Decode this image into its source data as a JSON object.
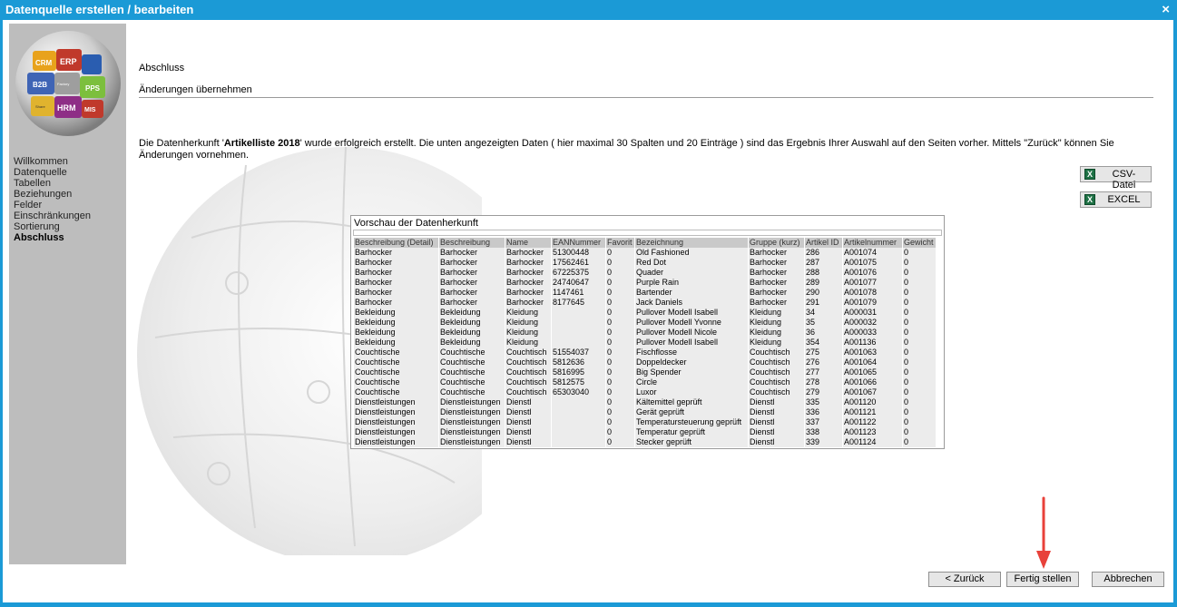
{
  "window": {
    "title": "Datenquelle erstellen / bearbeiten",
    "close_glyph": "×"
  },
  "logo": {
    "labels": [
      "CRM",
      "ERP",
      "B2B",
      "PPS",
      "HRM",
      "MIS"
    ],
    "small_labels": [
      "Factory",
      "Share"
    ]
  },
  "sidebar": {
    "items": [
      {
        "label": "Willkommen",
        "active": false
      },
      {
        "label": "Datenquelle",
        "active": false
      },
      {
        "label": "Tabellen",
        "active": false
      },
      {
        "label": "Beziehungen",
        "active": false
      },
      {
        "label": "Felder",
        "active": false
      },
      {
        "label": "Einschränkungen",
        "active": false
      },
      {
        "label": "Sortierung",
        "active": false
      },
      {
        "label": "Abschluss",
        "active": true
      }
    ]
  },
  "main": {
    "title": "Abschluss",
    "subtitle": "Änderungen übernehmen",
    "message_before": "Die Datenherkunft '",
    "message_name": "Artikelliste 2018",
    "message_after": "' wurde erfolgreich erstellt. Die unten angezeigten Daten ( hier maximal 30 Spalten und 20 Einträge ) sind das Ergebnis Ihrer Auswahl auf den Seiten vorher. Mittels \"Zurück\" können Sie Änderungen vornehmen."
  },
  "export": {
    "csv_label": "CSV-Datei",
    "excel_label": "EXCEL",
    "icon": "excel-icon",
    "icon_color": "#1e7145"
  },
  "preview": {
    "title": "Vorschau der Datenherkunft",
    "columns": [
      "Beschreibung (Detail)",
      "Beschreibung",
      "Name",
      "EANNummer",
      "Favorit",
      "Bezeichnung",
      "Gruppe (kurz)",
      "Artikel ID",
      "Artikelnummer",
      "Gewicht"
    ],
    "rows": [
      [
        "Barhocker",
        "Barhocker",
        "Barhocker",
        "51300448",
        "0",
        "Old Fashioned",
        "Barhocker",
        "286",
        "A001074",
        "0"
      ],
      [
        "Barhocker",
        "Barhocker",
        "Barhocker",
        "17562461",
        "0",
        "Red Dot",
        "Barhocker",
        "287",
        "A001075",
        "0"
      ],
      [
        "Barhocker",
        "Barhocker",
        "Barhocker",
        "67225375",
        "0",
        "Quader",
        "Barhocker",
        "288",
        "A001076",
        "0"
      ],
      [
        "Barhocker",
        "Barhocker",
        "Barhocker",
        "24740647",
        "0",
        "Purple Rain",
        "Barhocker",
        "289",
        "A001077",
        "0"
      ],
      [
        "Barhocker",
        "Barhocker",
        "Barhocker",
        "1147461",
        "0",
        "Bartender",
        "Barhocker",
        "290",
        "A001078",
        "0"
      ],
      [
        "Barhocker",
        "Barhocker",
        "Barhocker",
        "8177645",
        "0",
        "Jack Daniels",
        "Barhocker",
        "291",
        "A001079",
        "0"
      ],
      [
        "Bekleidung",
        "Bekleidung",
        "Kleidung",
        "",
        "0",
        "Pullover Modell Isabell",
        "Kleidung",
        "34",
        "A000031",
        "0"
      ],
      [
        "Bekleidung",
        "Bekleidung",
        "Kleidung",
        "",
        "0",
        "Pullover Modell Yvonne",
        "Kleidung",
        "35",
        "A000032",
        "0"
      ],
      [
        "Bekleidung",
        "Bekleidung",
        "Kleidung",
        "",
        "0",
        "Pullover Modell Nicole",
        "Kleidung",
        "36",
        "A000033",
        "0"
      ],
      [
        "Bekleidung",
        "Bekleidung",
        "Kleidung",
        "",
        "0",
        "Pullover Modell Isabell",
        "Kleidung",
        "354",
        "A001136",
        "0"
      ],
      [
        "Couchtische",
        "Couchtische",
        "Couchtisch",
        "51554037",
        "0",
        "Fischflosse",
        "Couchtisch",
        "275",
        "A001063",
        "0"
      ],
      [
        "Couchtische",
        "Couchtische",
        "Couchtisch",
        "5812636",
        "0",
        "Doppeldecker",
        "Couchtisch",
        "276",
        "A001064",
        "0"
      ],
      [
        "Couchtische",
        "Couchtische",
        "Couchtisch",
        "5816995",
        "0",
        "Big Spender",
        "Couchtisch",
        "277",
        "A001065",
        "0"
      ],
      [
        "Couchtische",
        "Couchtische",
        "Couchtisch",
        "5812575",
        "0",
        "Circle",
        "Couchtisch",
        "278",
        "A001066",
        "0"
      ],
      [
        "Couchtische",
        "Couchtische",
        "Couchtisch",
        "65303040",
        "0",
        "Luxor",
        "Couchtisch",
        "279",
        "A001067",
        "0"
      ],
      [
        "Dienstleistungen",
        "Dienstleistungen",
        "Dienstl",
        "",
        "0",
        "Kältemittel geprüft",
        "Dienstl",
        "335",
        "A001120",
        "0"
      ],
      [
        "Dienstleistungen",
        "Dienstleistungen",
        "Dienstl",
        "",
        "0",
        "Gerät geprüft",
        "Dienstl",
        "336",
        "A001121",
        "0"
      ],
      [
        "Dienstleistungen",
        "Dienstleistungen",
        "Dienstl",
        "",
        "0",
        "Temperatursteuerung geprüft",
        "Dienstl",
        "337",
        "A001122",
        "0"
      ],
      [
        "Dienstleistungen",
        "Dienstleistungen",
        "Dienstl",
        "",
        "0",
        "Temperatur geprüft",
        "Dienstl",
        "338",
        "A001123",
        "0"
      ],
      [
        "Dienstleistungen",
        "Dienstleistungen",
        "Dienstl",
        "",
        "0",
        "Stecker geprüft",
        "Dienstl",
        "339",
        "A001124",
        "0"
      ]
    ]
  },
  "footer": {
    "back_label": "< Zurück",
    "finish_label": "Fertig stellen",
    "cancel_label": "Abbrechen"
  },
  "colors": {
    "titlebar": "#1b9ad6",
    "sidebar": "#bdbdbd",
    "button_face": "#e6e6e6",
    "arrow": "#e8413a"
  }
}
